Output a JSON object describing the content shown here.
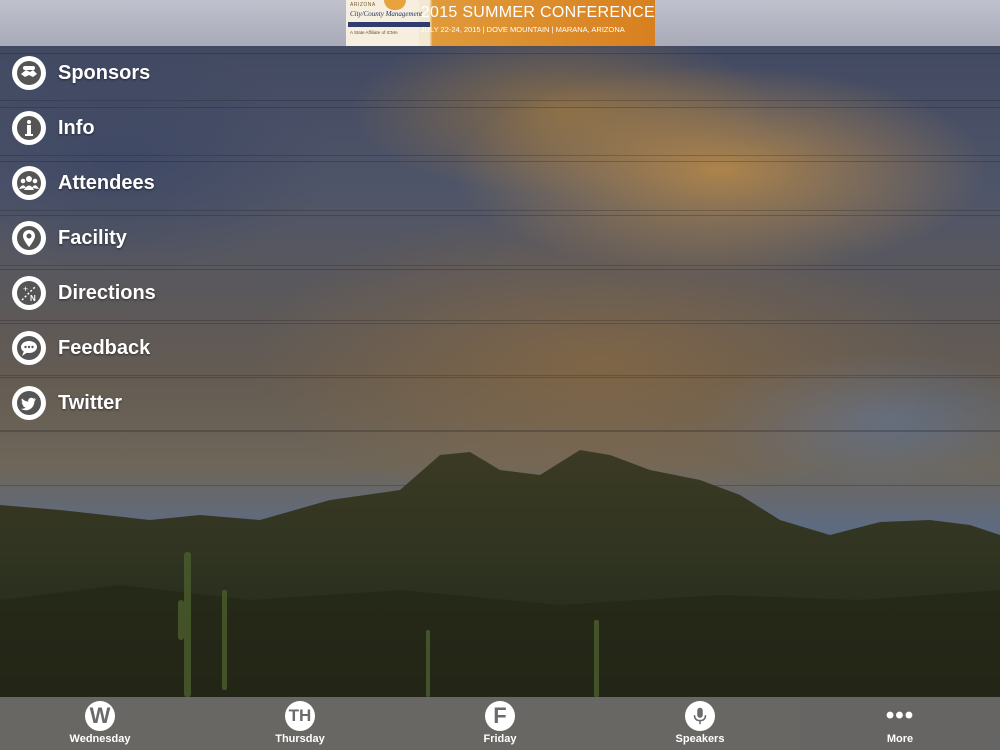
{
  "header": {
    "logo": {
      "top_text": "ARIZONA",
      "name": "City/County Management",
      "band_text": "ASSOCIATION",
      "sub_text": "A State Affiliate of ICMA"
    },
    "title": "2015 SUMMER CONFERENCE",
    "subtitle": "JULY 22-24, 2015 | DOVE MOUNTAIN | MARANA, ARIZONA"
  },
  "menu": {
    "items": [
      {
        "label": "Sponsors",
        "icon": "handshake-icon"
      },
      {
        "label": "Info",
        "icon": "info-icon"
      },
      {
        "label": "Attendees",
        "icon": "people-icon"
      },
      {
        "label": "Facility",
        "icon": "map-pin-icon"
      },
      {
        "label": "Directions",
        "icon": "compass-icon"
      },
      {
        "label": "Feedback",
        "icon": "chat-bubble-icon"
      },
      {
        "label": "Twitter",
        "icon": "twitter-bird-icon"
      }
    ]
  },
  "tabbar": {
    "tabs": [
      {
        "label": "Wednesday",
        "glyph": "W",
        "icon": "wednesday-icon"
      },
      {
        "label": "Thursday",
        "glyph": "TH",
        "icon": "thursday-icon"
      },
      {
        "label": "Friday",
        "glyph": "F",
        "icon": "friday-icon"
      },
      {
        "label": "Speakers",
        "glyph": "",
        "icon": "microphone-icon"
      },
      {
        "label": "More",
        "glyph": "•••",
        "icon": "more-dots-icon"
      }
    ],
    "active_index": 4
  },
  "colors": {
    "banner_orange": "#d8801f",
    "tabbar_bg": "#787676",
    "menu_text": "#ffffff"
  }
}
